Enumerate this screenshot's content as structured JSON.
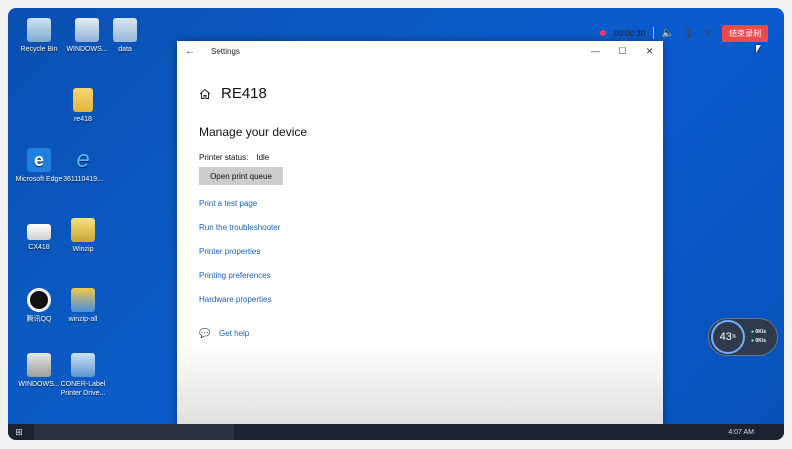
{
  "desktop": {
    "icons": [
      {
        "label": "Recycle Bin",
        "icon": "recycle-bin-icon"
      },
      {
        "label": "WINDOWS...",
        "icon": "computer-icon"
      },
      {
        "label": "data",
        "icon": "folder-icon"
      },
      {
        "label": "re418",
        "icon": "folder-icon"
      },
      {
        "label": "Microsoft Edge",
        "icon": "edge-icon"
      },
      {
        "label": "361110419...",
        "icon": "ie-icon"
      },
      {
        "label": "CX418",
        "icon": "printer-icon"
      },
      {
        "label": "Winzip",
        "icon": "winzip-icon"
      },
      {
        "label": "腾讯QQ",
        "icon": "qq-icon"
      },
      {
        "label": "winzip-all",
        "icon": "installer-icon"
      },
      {
        "label": "WINDOWS...",
        "icon": "archive-icon"
      },
      {
        "label": "CONER-Label Printer Drive...",
        "icon": "setup-icon"
      }
    ]
  },
  "recorder": {
    "time": "00:00:30",
    "stop_label": "结束录制",
    "record_color": "#ff3366",
    "stop_color": "#e94b4b"
  },
  "window": {
    "title": "Settings",
    "back": "←",
    "minimize": "—",
    "maximize": "☐",
    "close": "✕",
    "device_name": "RE418",
    "section_title": "Manage your device",
    "status_label": "Printer status:",
    "status_value": "Idle",
    "open_queue_label": "Open print queue",
    "links": [
      "Print a test page",
      "Run the troubleshooter",
      "Printer properties",
      "Printing preferences",
      "Hardware properties"
    ],
    "help_label": "Get help",
    "link_color": "#1a5fb4"
  },
  "speed_widget": {
    "percent": "43",
    "unit": "%",
    "up": "0K/s",
    "down": "0K/s"
  },
  "taskbar": {
    "time": "4:07 AM"
  }
}
